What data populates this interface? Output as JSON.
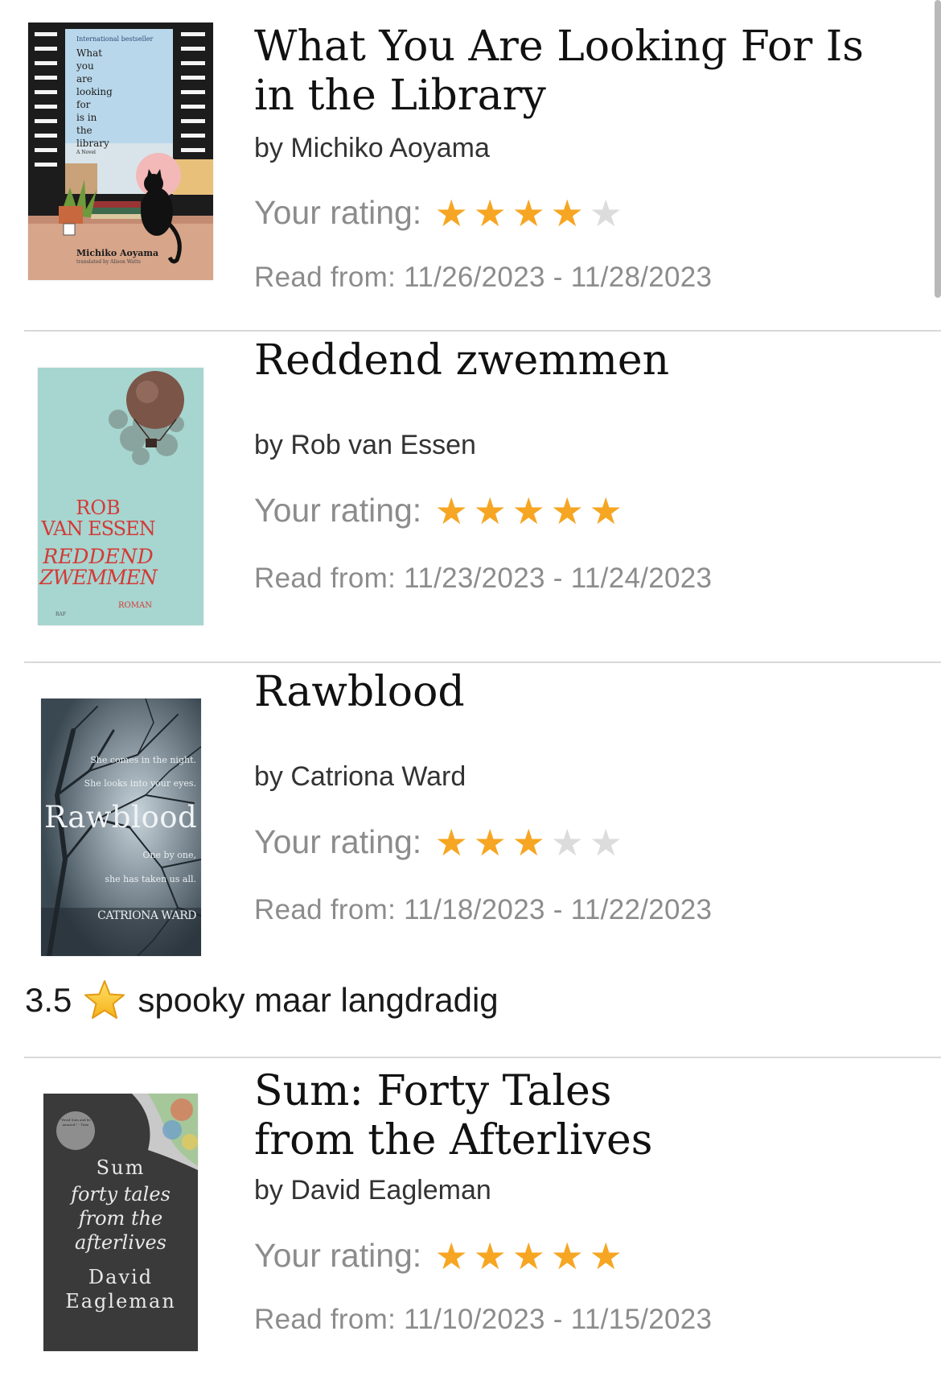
{
  "rating_label": "Your rating:",
  "dates_label": "Read from:",
  "colors": {
    "star_on": "#f6a623",
    "star_off": "#dcdcdc"
  },
  "books": [
    {
      "title": "What You Are Looking For Is in the Library",
      "author": "by Michiko Aoyama",
      "rating": 4,
      "dates": "11/26/2023 - 11/28/2023",
      "cover": {
        "lines": [
          "International bestseller",
          "What",
          "you",
          "are",
          "looking",
          "for",
          "is in",
          "the",
          "library",
          "A Novel"
        ],
        "author": "Michiko Aoyama",
        "translator": "translated by Alison Watts"
      }
    },
    {
      "title": "Reddend zwemmen",
      "author": "by Rob van Essen",
      "rating": 5,
      "dates": "11/23/2023 - 11/24/2023",
      "cover": {
        "author_line1": "ROB",
        "author_line2": "VAN ESSEN",
        "title_line1": "REDDEND",
        "title_line2": "ZWEMMEN",
        "genre": "ROMAN",
        "publisher": "RAF"
      }
    },
    {
      "title": "Rawblood",
      "author": "by Catriona Ward",
      "rating": 3,
      "dates": "11/18/2023 - 11/22/2023",
      "cover": {
        "tag1": "She comes in the night.",
        "tag2": "She looks into your eyes.",
        "title": "Rawblood",
        "tag3": "One by one,",
        "tag4": "she has taken us all.",
        "author": "CATRIONA WARD"
      },
      "review": {
        "score": "3.5",
        "icon": "star-emoji",
        "text": "spooky maar langdradig"
      }
    },
    {
      "title": "Sum: Forty Tales from the Afterlives",
      "author": "by David Eagleman",
      "rating": 5,
      "dates": "11/10/2023 - 11/15/2023",
      "cover": {
        "badge": "\"Read Sum and be amazed.\" - Time",
        "title_top": "Sum",
        "subtitle": [
          "forty tales",
          "from the",
          "afterlives"
        ],
        "author1": "David",
        "author2": "Eagleman"
      }
    }
  ]
}
